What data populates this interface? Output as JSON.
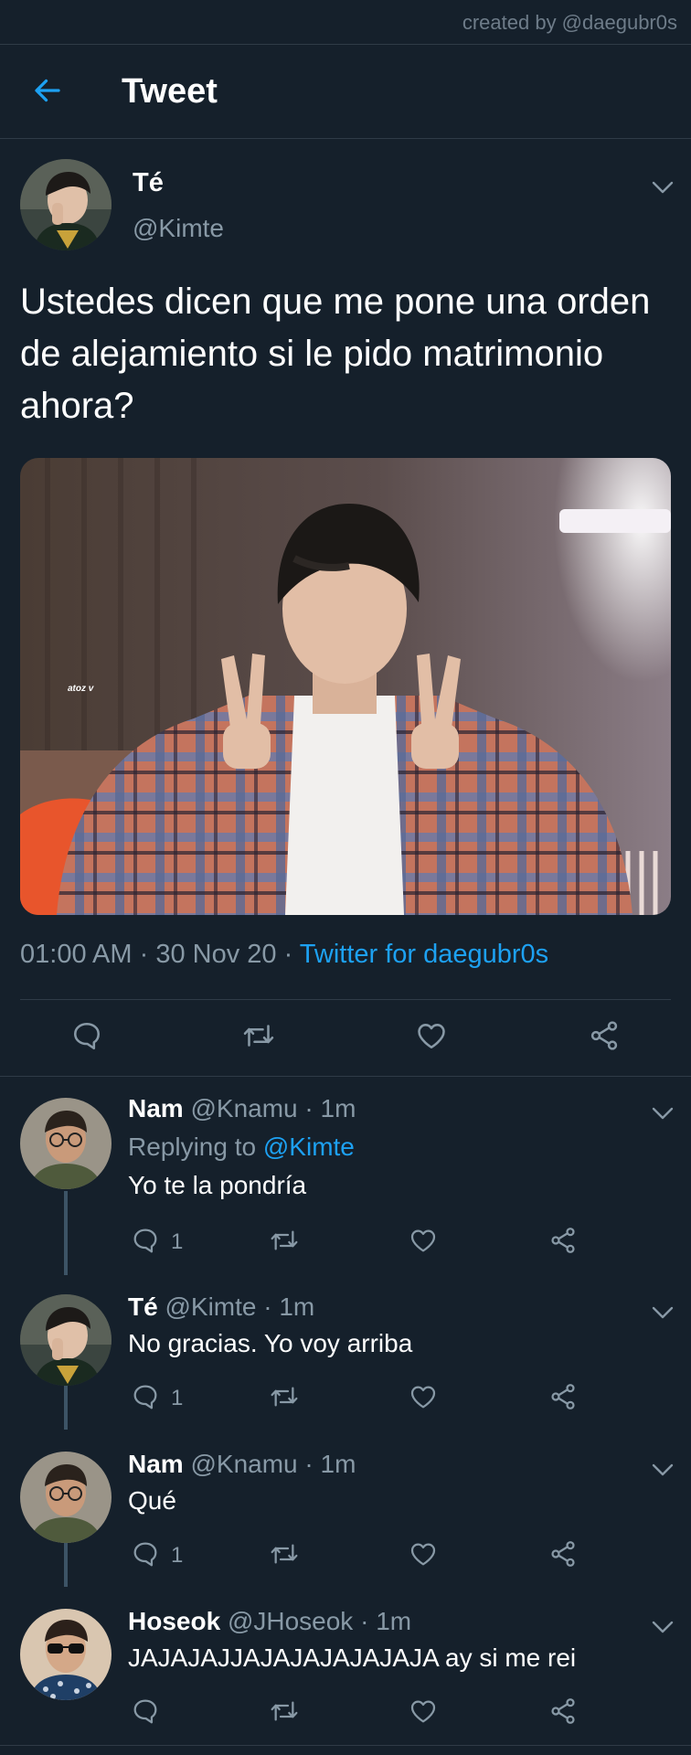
{
  "credit": "created by @daegubr0s",
  "header": {
    "title": "Tweet"
  },
  "tweet": {
    "name": "Té",
    "handle": "@Kimte",
    "text": "Ustedes dicen que me pone una orden de alejamiento si le pido matrimonio ahora?",
    "media_watermark": "atoz v",
    "time": "01:00 AM",
    "date": "30 Nov 20",
    "separator": " · ",
    "source": "Twitter for daegubr0s"
  },
  "replies": [
    {
      "name": "Nam",
      "handle": "@Knamu",
      "time": "1m",
      "replying_prefix": "Replying to ",
      "replying_handle": "@Kimte",
      "text": "Yo te la pondría",
      "reply_count": "1"
    },
    {
      "name": "Té",
      "handle": "@Kimte",
      "time": "1m",
      "text": "No gracias. Yo voy arriba",
      "reply_count": "1"
    },
    {
      "name": "Nam",
      "handle": "@Knamu",
      "time": "1m",
      "text": "Qué",
      "reply_count": "1"
    },
    {
      "name": "Hoseok",
      "handle": "@JHoseok",
      "time": "1m",
      "text": "JAJAJAJJAJAJAJAJAJAJA ay si me rei",
      "reply_count": ""
    }
  ],
  "icons": {
    "back": "arrow-left-icon",
    "more": "chevron-down-icon",
    "reply": "speech-bubble-icon",
    "retweet": "retweet-icon",
    "like": "heart-icon",
    "share": "share-icon"
  },
  "colors": {
    "background": "#15202b",
    "accent": "#1da1f2",
    "secondary_text": "#8899a6",
    "divider": "#2f3b47"
  }
}
